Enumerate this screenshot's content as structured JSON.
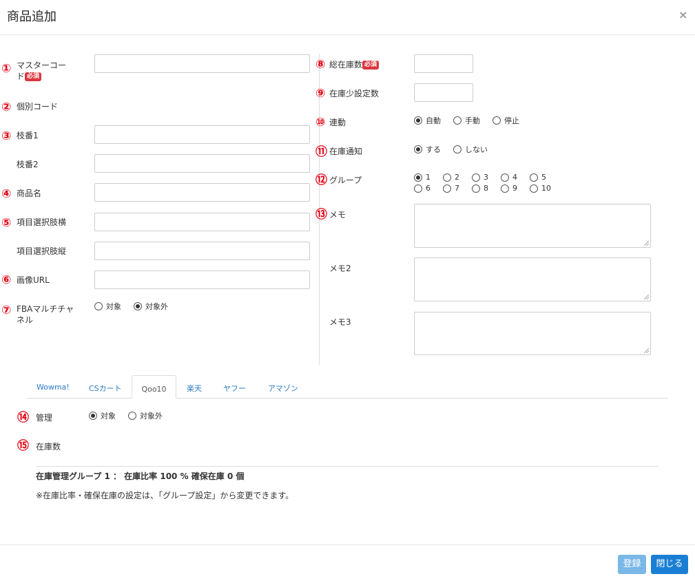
{
  "dialog": {
    "title": "商品追加",
    "close": "×"
  },
  "left_fields": {
    "master_code": {
      "num": "①",
      "label": "マスターコード",
      "label2": "ド",
      "label1": "マスターコー",
      "badge": "必須"
    },
    "item_code": {
      "num": "②",
      "label": "個別コード"
    },
    "branch1": {
      "num": "③",
      "label": "枝番1"
    },
    "branch2": {
      "label": "枝番2"
    },
    "product_name": {
      "num": "④",
      "label": "商品名"
    },
    "option_h": {
      "num": "⑤",
      "label": "項目選択肢横"
    },
    "option_v": {
      "label": "項目選択肢縦"
    },
    "image_url": {
      "num": "⑥",
      "label": "画像URL"
    },
    "fba": {
      "num": "⑦",
      "label1": "FBAマルチチャ",
      "label2": "ネル",
      "options": [
        "対象",
        "対象外"
      ],
      "selected": "対象外"
    }
  },
  "right_fields": {
    "total_stock": {
      "num": "⑧",
      "label": "総在庫数",
      "badge": "必須"
    },
    "low_stock": {
      "num": "⑨",
      "label": "在庫少設定数"
    },
    "link": {
      "num": "⑩",
      "label": "連動",
      "options": [
        "自動",
        "手動",
        "停止"
      ],
      "selected": "自動"
    },
    "notify": {
      "num": "⑪",
      "label": "在庫通知",
      "options": [
        "する",
        "しない"
      ],
      "selected": "する"
    },
    "group": {
      "num": "⑫",
      "label": "グループ",
      "options": [
        "1",
        "2",
        "3",
        "4",
        "5",
        "6",
        "7",
        "8",
        "9",
        "10"
      ],
      "selected": "1"
    },
    "memo": {
      "num": "⑬",
      "label": "メモ"
    },
    "memo2": {
      "label": "メモ2"
    },
    "memo3": {
      "label": "メモ3"
    }
  },
  "tabs": [
    "Wowma!",
    "CSカート",
    "Qoo10",
    "楽天",
    "ヤフー",
    "アマゾン"
  ],
  "active_tab": "Qoo10",
  "tab_panel": {
    "manage": {
      "num": "⑭",
      "label": "管理",
      "options": [
        "対象",
        "対象外"
      ],
      "selected": "対象"
    },
    "stock": {
      "num": "⑮",
      "label": "在庫数"
    },
    "summary": "在庫管理グループ 1 ： 在庫比率 100 % 確保在庫 0 個",
    "note": "※在庫比率・確保在庫の設定は、「グループ設定」から変更できます。"
  },
  "footer": {
    "register": "登録",
    "close": "閉じる"
  },
  "colors": {
    "register_btn": "#7ab8e8",
    "close_btn": "#1a7fd4",
    "required_badge": "#d9363e",
    "number_marker": "#e60012",
    "tab_link": "#2a7bc4"
  }
}
